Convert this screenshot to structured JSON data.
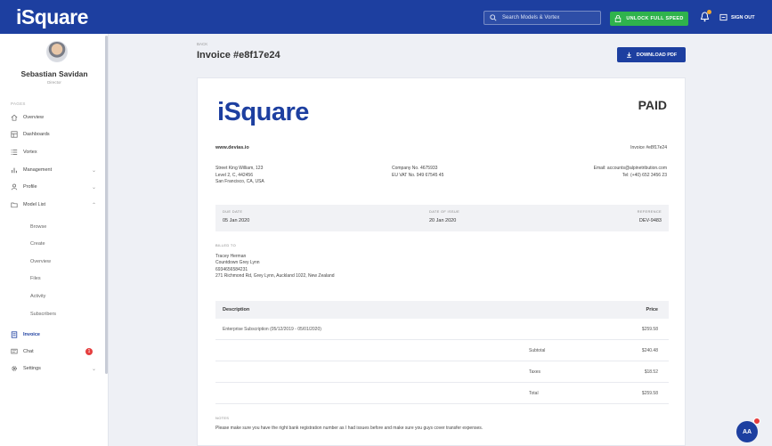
{
  "app": {
    "logo": "iSquare"
  },
  "topbar": {
    "search_placeholder": "Search Models & Vortex",
    "unlock_label": "UNLOCK FULL SPEED",
    "signout_label": "SIGN OUT",
    "colors": {
      "primary": "#1d3fa0",
      "unlock": "#2fb34c"
    }
  },
  "user": {
    "name": "Sebastian Savidan",
    "role": "Director"
  },
  "sidebar": {
    "section_label": "PAGES",
    "items": [
      {
        "label": "Overview",
        "icon": "home-icon"
      },
      {
        "label": "Dashboards",
        "icon": "dashboard-icon"
      },
      {
        "label": "Vortex",
        "icon": "list-icon"
      },
      {
        "label": "Management",
        "icon": "chart-icon",
        "chevron": "⌄"
      },
      {
        "label": "Profile",
        "icon": "user-icon",
        "chevron": "⌄"
      },
      {
        "label": "Model List",
        "icon": "folder-icon",
        "chevron": "⌃"
      }
    ],
    "sub_items": [
      "Browse",
      "Create",
      "Overview",
      "Files",
      "Activity",
      "Subscribers"
    ],
    "bottom_items": [
      {
        "label": "Invoice",
        "icon": "invoice-icon",
        "active": true
      },
      {
        "label": "Chat",
        "icon": "chat-icon",
        "badge": "1"
      },
      {
        "label": "Settings",
        "icon": "gear-icon",
        "chevron": "⌄"
      }
    ]
  },
  "header": {
    "back": "BACK",
    "title": "Invoice #e8f17e24",
    "download_label": "DOWNLOAD PDF"
  },
  "invoice": {
    "logo": "iSquare",
    "status": "PAID",
    "website": "www.devias.io",
    "number": "Invoice #e8f17e24",
    "address": [
      "Street King William, 123",
      "Level 2, C, 442456",
      "San Francisco, CA, USA"
    ],
    "company": [
      "Company No. 4675933",
      "EU VAT No. 949 67545 45"
    ],
    "contact": [
      "Email: accounts@alpinetribution.com",
      "Tel: (+40) 652 3456 23"
    ],
    "dates": {
      "due_label": "DUE DATE",
      "due": "05 Jan 2020",
      "issue_label": "DATE OF ISSUE",
      "issue": "20 Jan 2020",
      "ref_label": "REFERENCE",
      "ref": "DEV-9483"
    },
    "billed": {
      "label": "BILLED TO",
      "lines": [
        "Tracey Herman",
        "Countdown Grey Lynn",
        "6934656584231",
        "271 Richmond Rd, Grey Lynn, Auckland 1022, New Zealand"
      ]
    },
    "table": {
      "headers": {
        "description": "Description",
        "price": "Price"
      },
      "item": {
        "description": "Enterprise Subscription (05/12/2019 - 05/01/2020)",
        "price": "$259.58"
      },
      "subtotal": {
        "label": "Subtotal",
        "value": "$240.48"
      },
      "taxes": {
        "label": "Taxes",
        "value": "$18.52"
      },
      "total": {
        "label": "Total",
        "value": "$259.58"
      }
    },
    "notes": {
      "label": "NOTES",
      "text": "Please make sure you have the right bank registration number as I had issues before and make sure you guys cover transfer expenses."
    }
  },
  "fab": {
    "label": "AA"
  }
}
